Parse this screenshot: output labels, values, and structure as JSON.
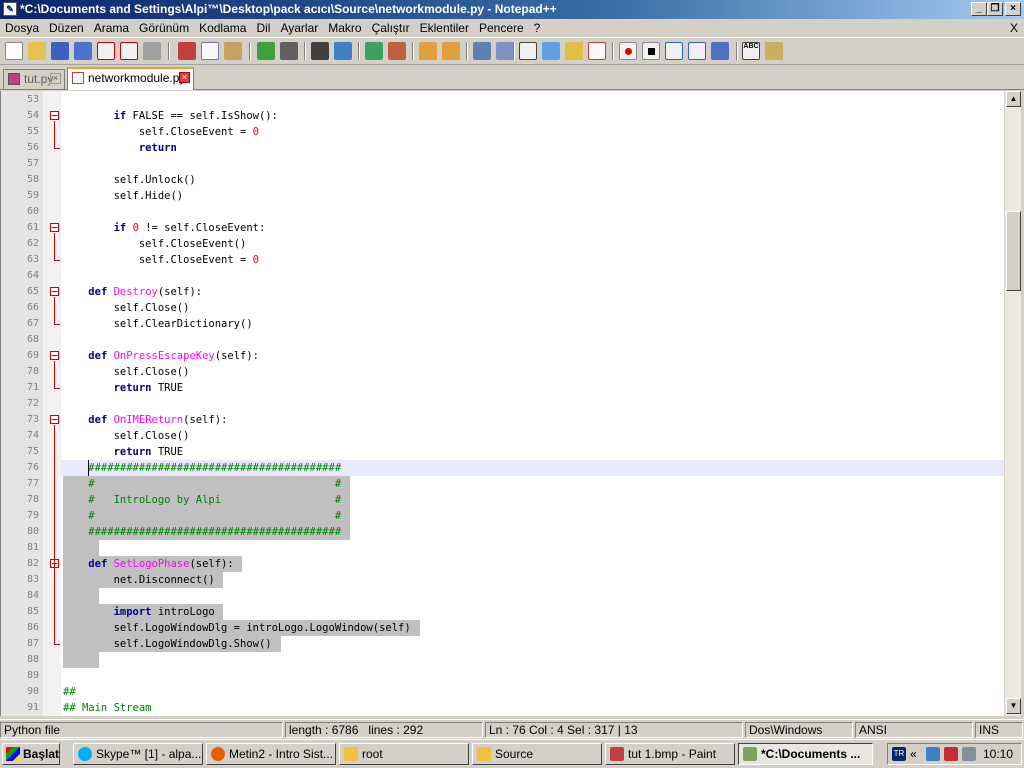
{
  "window": {
    "title": "*C:\\Documents and Settings\\Alpi™\\Desktop\\pack acıcı\\Source\\networkmodule.py - Notepad++"
  },
  "menu": {
    "items": [
      "Dosya",
      "Düzen",
      "Arama",
      "Görünüm",
      "Kodlama",
      "Dil",
      "Ayarlar",
      "Makro",
      "Çalıştır",
      "Eklentiler",
      "Pencere",
      "?"
    ],
    "close_label": "X"
  },
  "tabs": [
    {
      "label": "tut.py",
      "active": false
    },
    {
      "label": "networkmodule.py",
      "active": true
    }
  ],
  "editor": {
    "lines": [
      {
        "n": "53",
        "text": ""
      },
      {
        "n": "54",
        "text": "        if FALSE == self.IsShow():"
      },
      {
        "n": "55",
        "text": "            self.CloseEvent = 0"
      },
      {
        "n": "56",
        "text": "            return"
      },
      {
        "n": "57",
        "text": ""
      },
      {
        "n": "58",
        "text": "        self.Unlock()"
      },
      {
        "n": "59",
        "text": "        self.Hide()"
      },
      {
        "n": "60",
        "text": ""
      },
      {
        "n": "61",
        "text": "        if 0 != self.CloseEvent:"
      },
      {
        "n": "62",
        "text": "            self.CloseEvent()"
      },
      {
        "n": "63",
        "text": "            self.CloseEvent = 0"
      },
      {
        "n": "64",
        "text": ""
      },
      {
        "n": "65",
        "text": "    def Destroy(self):"
      },
      {
        "n": "66",
        "text": "        self.Close()"
      },
      {
        "n": "67",
        "text": "        self.ClearDictionary()"
      },
      {
        "n": "68",
        "text": ""
      },
      {
        "n": "69",
        "text": "    def OnPressEscapeKey(self):"
      },
      {
        "n": "70",
        "text": "        self.Close()"
      },
      {
        "n": "71",
        "text": "        return TRUE"
      },
      {
        "n": "72",
        "text": ""
      },
      {
        "n": "73",
        "text": "    def OnIMEReturn(self):"
      },
      {
        "n": "74",
        "text": "        self.Close()"
      },
      {
        "n": "75",
        "text": "        return TRUE"
      },
      {
        "n": "76",
        "text": "    ########################################"
      },
      {
        "n": "77",
        "text": "    #                                      #"
      },
      {
        "n": "78",
        "text": "    #   IntroLogo by Alpi                  #"
      },
      {
        "n": "79",
        "text": "    #                                      #"
      },
      {
        "n": "80",
        "text": "    ########################################"
      },
      {
        "n": "81",
        "text": ""
      },
      {
        "n": "82",
        "text": "    def SetLogoPhase(self):"
      },
      {
        "n": "83",
        "text": "        net.Disconnect()"
      },
      {
        "n": "84",
        "text": ""
      },
      {
        "n": "85",
        "text": "        import introLogo"
      },
      {
        "n": "86",
        "text": "        self.LogoWindowDlg = introLogo.LogoWindow(self)"
      },
      {
        "n": "87",
        "text": "        self.LogoWindowDlg.Show()"
      },
      {
        "n": "88",
        "text": ""
      },
      {
        "n": "89",
        "text": ""
      },
      {
        "n": "90",
        "text": "##"
      },
      {
        "n": "91",
        "text": "## Main Stream"
      }
    ]
  },
  "statusbar": {
    "filetype": "Python file",
    "length": "length : 6786",
    "lines": "lines : 292",
    "position": "Ln : 76    Col : 4    Sel : 317 | 13",
    "eol": "Dos\\Windows",
    "encoding": "ANSI",
    "mode": "INS"
  },
  "taskbar": {
    "start_label": "Başlat",
    "tasks": [
      {
        "label": "Skype™ [1] - alpa...",
        "color": "#00aff0"
      },
      {
        "label": "Metin2 - Intro Sist...",
        "color": "#e66000"
      },
      {
        "label": "root",
        "color": "#f0c040"
      },
      {
        "label": "Source",
        "color": "#f0c040"
      },
      {
        "label": "tut 1.bmp - Paint",
        "color": "#c04040"
      },
      {
        "label": "*C:\\Documents ...",
        "color": "#80a060"
      }
    ],
    "lang": "TR",
    "clock": "10:10"
  }
}
